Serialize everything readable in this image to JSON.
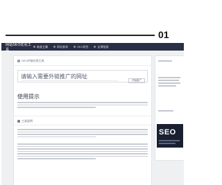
{
  "banner": {
    "number": "01"
  },
  "navbar": {
    "logo": "网站SEO优化工具",
    "items": [
      {
        "label": "站长工具"
      },
      {
        "label": "网站查询"
      },
      {
        "label": "SEO综合"
      },
      {
        "label": "友情链接"
      }
    ]
  },
  "breadcrumb": {
    "label": "SEO外链在线工具"
  },
  "search": {
    "placeholder": "请输入需要外链推广的网址",
    "button_label": "开始推广"
  },
  "usage": {
    "title": "使用提示"
  },
  "tool_intro": {
    "label": "工具说明"
  },
  "sidebar": {
    "seo_logo": "SEO"
  }
}
